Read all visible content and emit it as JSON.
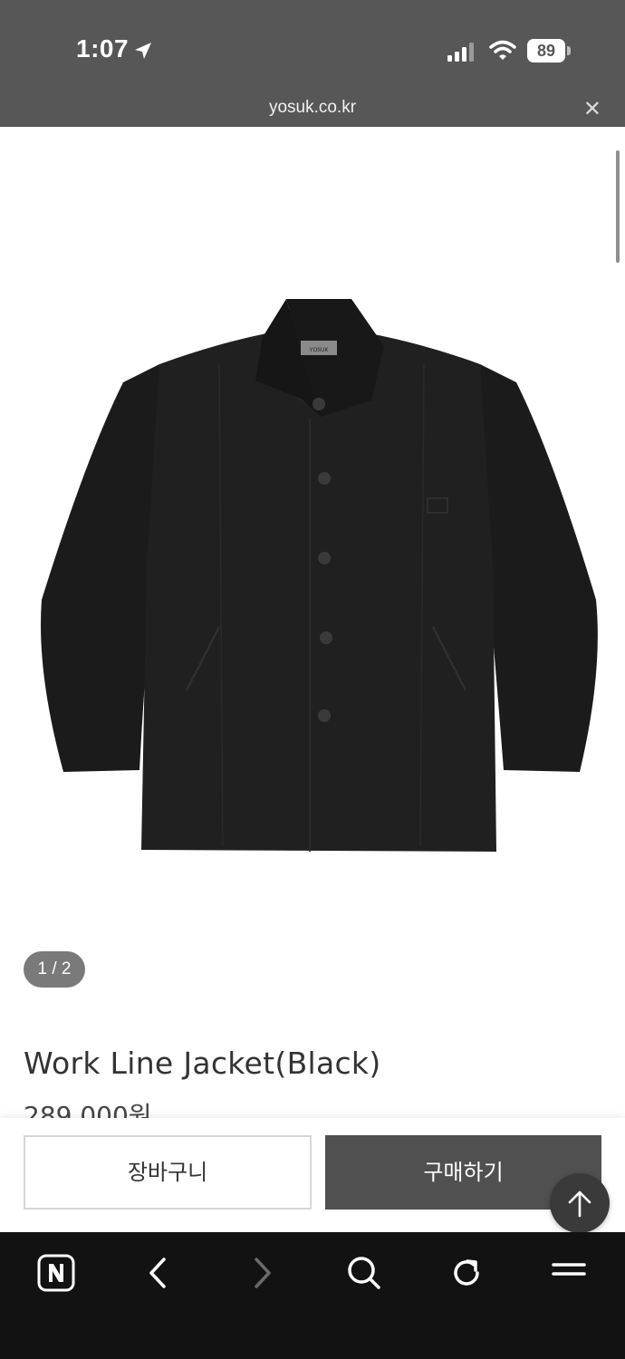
{
  "status_bar": {
    "time": "1:07",
    "battery": "89"
  },
  "browser": {
    "url": "yosuk.co.kr",
    "close_label": "✕"
  },
  "product": {
    "image_alt": "Black work line jacket",
    "brand_tag": "YOSUK",
    "pager": "1 / 2",
    "name": "Work Line Jacket(Black)",
    "price": "289,000원"
  },
  "actions": {
    "cart_label": "장바구니",
    "buy_label": "구매하기"
  },
  "icons": {
    "location": "location-arrow-icon",
    "signal": "cellular-signal-icon",
    "wifi": "wifi-icon",
    "battery": "battery-icon",
    "top": "arrow-up-icon",
    "home": "naver-n-icon",
    "back": "chevron-left-icon",
    "forward": "chevron-right-icon",
    "search": "search-icon",
    "reload": "reload-icon",
    "menu": "hamburger-menu-icon"
  },
  "colors": {
    "status_bg": "#575757",
    "buy_button": "#505050",
    "toolbar_bg": "#121212",
    "pager_bg": "#7a7a7a"
  }
}
